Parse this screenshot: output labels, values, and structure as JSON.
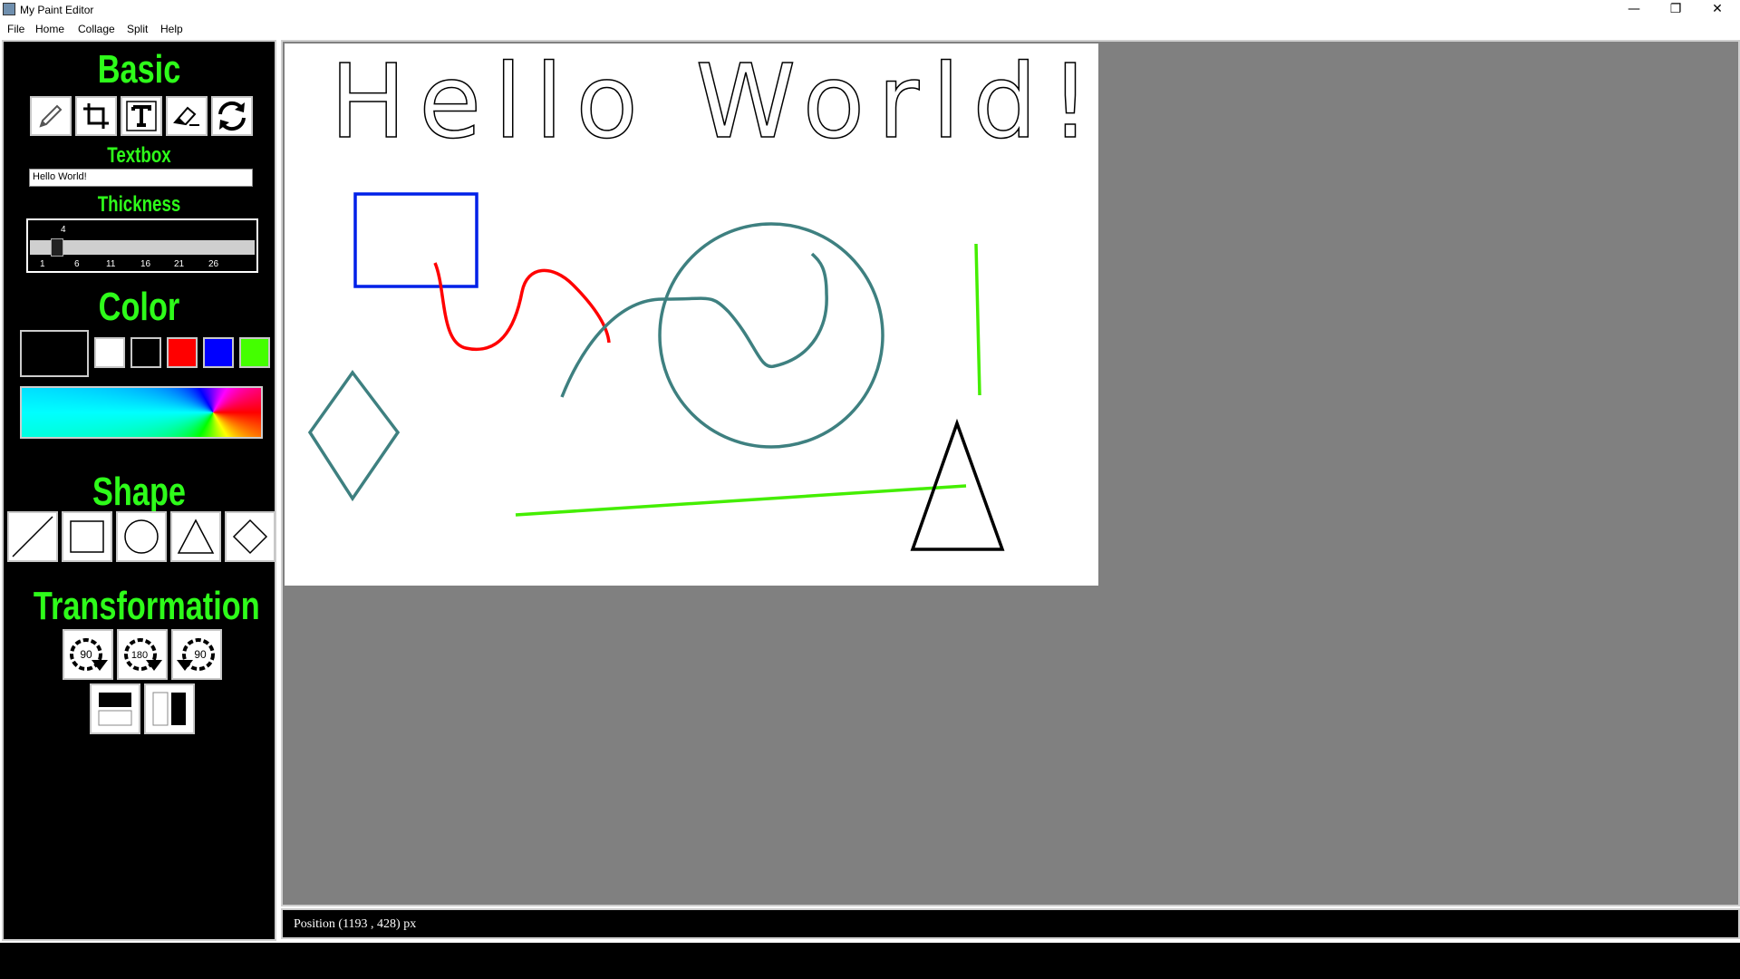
{
  "window": {
    "title": "My Paint Editor",
    "minimize": "—",
    "restore": "❐",
    "close": "✕"
  },
  "menu": [
    "File",
    "Home",
    "Collage",
    "Split",
    "Help"
  ],
  "sidebar": {
    "basic": {
      "heading": "Basic",
      "tools": [
        "pencil-icon",
        "crop-icon",
        "text-icon",
        "eraser-icon",
        "refresh-icon"
      ]
    },
    "textbox": {
      "heading": "Textbox",
      "value": "Hello World!"
    },
    "thickness": {
      "heading": "Thickness",
      "value": "4",
      "ticks": [
        "1",
        "6",
        "11",
        "16",
        "21",
        "26"
      ]
    },
    "color": {
      "heading": "Color",
      "current": "#000000",
      "swatches": [
        "#ffffff",
        "#000000",
        "#ff0000",
        "#0000ff",
        "#44ff00"
      ]
    },
    "shape": {
      "heading": "Shape",
      "tools": [
        "line-icon",
        "rectangle-icon",
        "circle-icon",
        "triangle-icon",
        "diamond-icon"
      ]
    },
    "transformation": {
      "heading": "Transformation",
      "rotate_cw_90": "90",
      "rotate_180": "180",
      "rotate_ccw_90": "90",
      "flip_tools": [
        "flip-vertical-icon",
        "flip-horizontal-icon"
      ]
    }
  },
  "canvas": {
    "text": "Hello World!"
  },
  "status": {
    "position": "Position (1193 , 428) px"
  }
}
